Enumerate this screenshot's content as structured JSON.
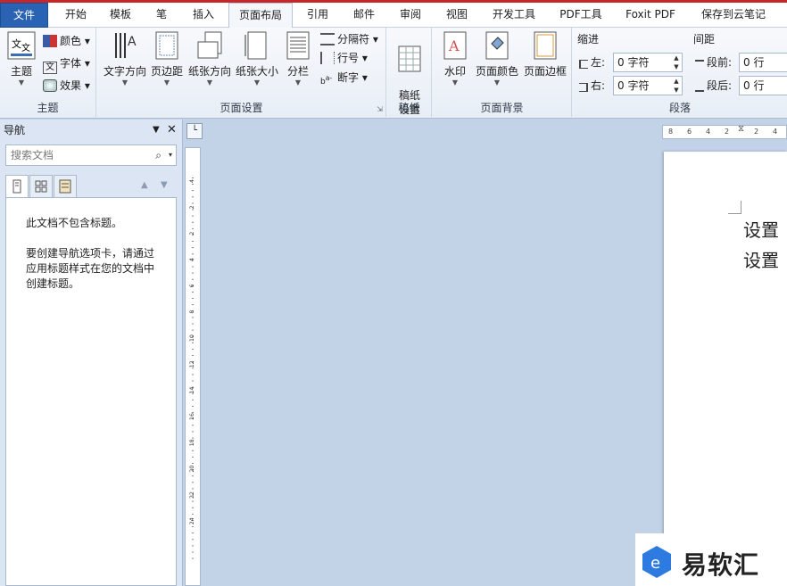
{
  "tabs": [
    "文件",
    "开始",
    "模板",
    "笔",
    "插入",
    "页面布局",
    "引用",
    "邮件",
    "审阅",
    "视图",
    "开发工具",
    "PDF工具",
    "Foxit PDF",
    "保存到云笔记"
  ],
  "ribbon": {
    "theme": {
      "label": "主题",
      "big": "主题",
      "colors": "颜色",
      "fonts": "字体",
      "effects": "效果"
    },
    "page_setup": {
      "label": "页面设置",
      "text_dir": "文字方向",
      "margins": "页边距",
      "orientation": "纸张方向",
      "size": "纸张大小",
      "columns": "分栏",
      "breaks": "分隔符",
      "line_numbers": "行号",
      "hyphenation": "断字"
    },
    "manuscript": {
      "label": "稿纸",
      "btn": "稿纸\n设置"
    },
    "background": {
      "label": "页面背景",
      "watermark": "水印",
      "page_color": "页面颜色",
      "page_border": "页面边框"
    },
    "paragraph": {
      "label": "段落",
      "indent": "缩进",
      "spacing": "间距",
      "left": "左:",
      "right": "右:",
      "left_val": "0 字符",
      "right_val": "0 字符",
      "before": "段前:",
      "after": "段后:",
      "before_val": "0 行",
      "after_val": "0 行"
    }
  },
  "nav": {
    "title": "导航",
    "search_placeholder": "搜索文档",
    "msg1": "此文档不包含标题。",
    "msg2": "要创建导航选项卡，请通过应用标题样式在您的文档中创建标题。"
  },
  "ruler": {
    "h_ticks": [
      "8",
      "6",
      "4",
      "2",
      "2",
      "4"
    ],
    "v_ticks": [
      "4",
      "2",
      "2",
      "4",
      "6",
      "8",
      "10",
      "12",
      "14",
      "16",
      "18",
      "20",
      "22",
      "24"
    ]
  },
  "doc": {
    "line1": "设置",
    "line2": "设置"
  },
  "watermark": {
    "text": "易软汇"
  }
}
